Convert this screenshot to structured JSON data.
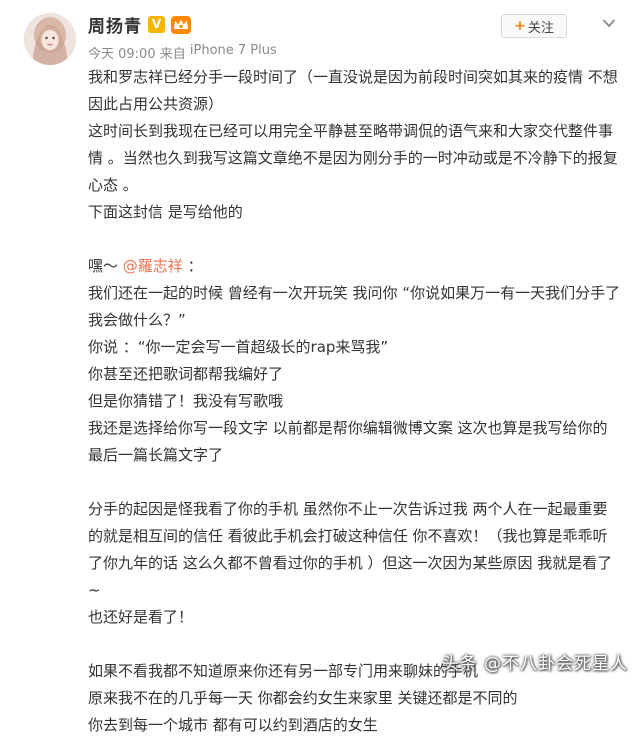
{
  "post": {
    "username": "周扬青",
    "vip_badge": "V",
    "time": "今天 09:00",
    "source_prefix": " 来自 ",
    "source_device": "iPhone 7 Plus",
    "follow_label": "关注",
    "follow_plus": "+"
  },
  "body": {
    "lines": [
      "我和罗志祥已经分手一段时间了（一直没说是因为前段时间突如其来的疫情 不想",
      "因此占用公共资源）",
      "这时间长到我现在已经可以用完全平静甚至略带调侃的语气来和大家交代整件事",
      "情 。当然也久到我写这篇文章绝不是因为刚分手的一时冲动或是不冷静下的报复",
      "心态 。",
      "下面这封信 是写给他的",
      "",
      "@mention",
      "我们还在一起的时候 曾经有一次开玩笑 我问你 “你说如果万一有一天我们分手了",
      "我会做什么？”",
      "你说 ：“你一定会写一首超级长的rap来骂我”",
      "你甚至还把歌词都帮我编好了",
      "但是你猜错了！我没有写歌哦",
      "我还是选择给你写一段文字  以前都是帮你编辑微博文案 这次也算是我写给你的",
      "最后一篇长篇文字了",
      "",
      "分手的起因是怪我看了你的手机  虽然你不止一次告诉过我  两个人在一起最重要",
      "的就是相互间的信任  看彼此手机会打破这种信任 你不喜欢！（我也算是乖乖听",
      "了你九年的话 这么久都不曾看过你的手机 ）但这一次因为某些原因  我就是看了",
      "~",
      "也还好是看了！",
      "",
      "如果不看我都不知道原来你还有另一部专门用来聊妹的手机",
      "原来我不在的几乎每一天  你都会约女生来家里 关键还都是不同的",
      "你去到每一个城市 都有可以约到酒店的女生"
    ],
    "greeting_prefix": "嘿～ ",
    "mention": "@羅志祥",
    "greeting_suffix": " ："
  },
  "watermark": "头条 @不八卦会死星人",
  "colors": {
    "mention": "#eb7350",
    "follow_plus": "#ff8200",
    "meta": "#8a8a8a"
  },
  "icons": {
    "vip": "vip-v-icon",
    "member": "member-crown-icon",
    "menu": "chevron-down-icon"
  }
}
